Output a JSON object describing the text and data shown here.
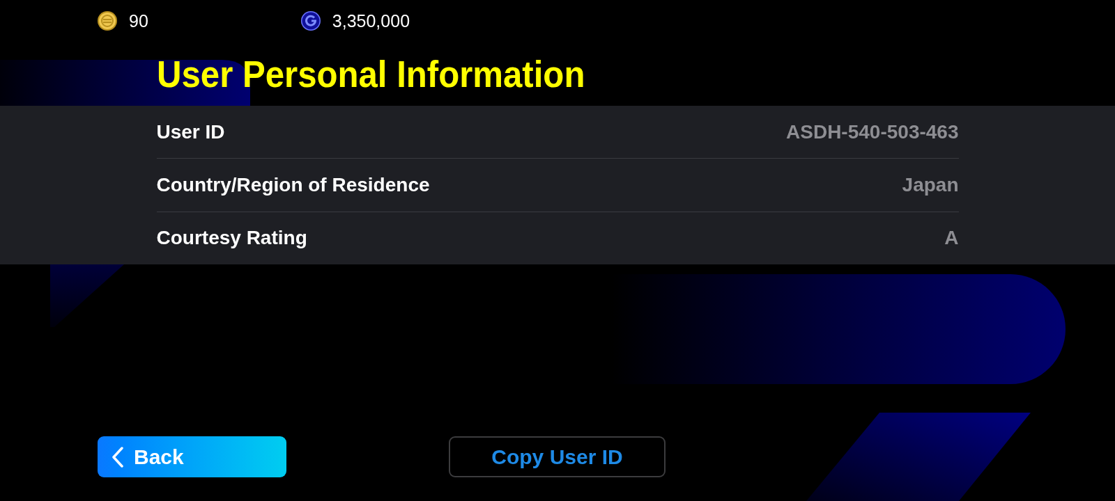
{
  "currencies": [
    {
      "kind": "coin",
      "amount": "90"
    },
    {
      "kind": "gp",
      "amount": "3,350,000"
    }
  ],
  "title": "User Personal Information",
  "info_rows": [
    {
      "label": "User ID",
      "value": "ASDH-540-503-463"
    },
    {
      "label": "Country/Region of Residence",
      "value": "Japan"
    },
    {
      "label": "Courtesy Rating",
      "value": "A"
    }
  ],
  "buttons": [
    {
      "kind": "back",
      "label": "Back"
    },
    {
      "kind": "outline",
      "label": "Copy User ID"
    }
  ]
}
